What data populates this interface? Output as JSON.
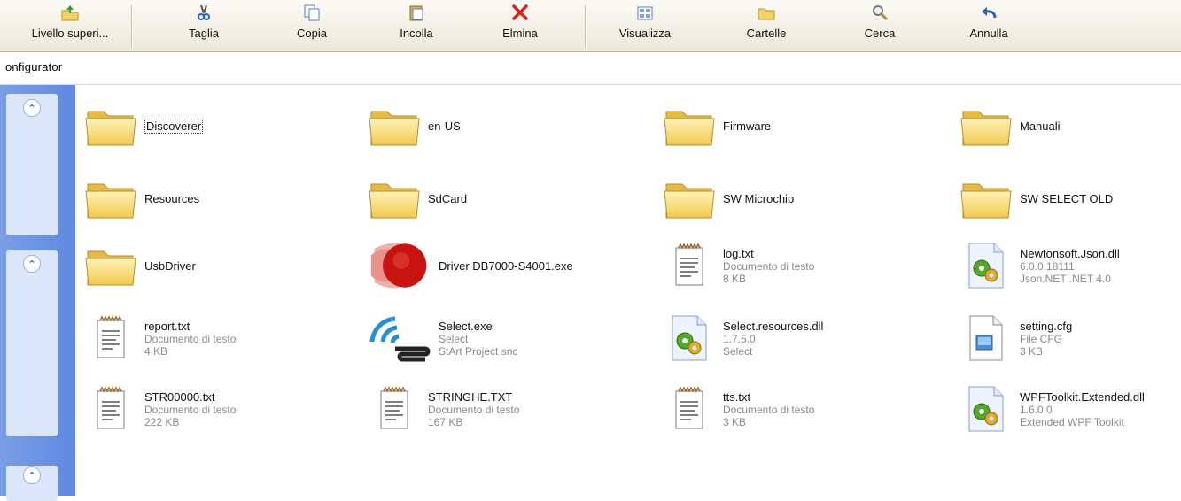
{
  "toolbar": {
    "buttons": [
      {
        "label": "Livello superi...",
        "icon": "folder-up-icon"
      },
      {
        "label": "Taglia",
        "icon": "scissors-icon"
      },
      {
        "label": "Copia",
        "icon": "copy-icon"
      },
      {
        "label": "Incolla",
        "icon": "paste-icon"
      },
      {
        "label": "Elmina",
        "icon": "delete-icon"
      },
      {
        "label": "Visualizza",
        "icon": "view-icon"
      },
      {
        "label": "Cartelle",
        "icon": "folders-icon"
      },
      {
        "label": "Cerca",
        "icon": "search-icon"
      },
      {
        "label": "Annulla",
        "icon": "undo-icon"
      }
    ]
  },
  "address": {
    "text": "onfigurator"
  },
  "files": [
    {
      "name": "Discoverer",
      "type": "folder",
      "selected": true
    },
    {
      "name": "en-US",
      "type": "folder"
    },
    {
      "name": "Firmware",
      "type": "folder"
    },
    {
      "name": "Manuali",
      "type": "folder"
    },
    {
      "name": "Resources",
      "type": "folder"
    },
    {
      "name": "SdCard",
      "type": "folder"
    },
    {
      "name": "SW Microchip",
      "type": "folder"
    },
    {
      "name": "SW SELECT OLD",
      "type": "folder"
    },
    {
      "name": "UsbDriver",
      "type": "folder"
    },
    {
      "name": "Driver DB7000-S4001.exe",
      "type": "exe-red"
    },
    {
      "name": "log.txt",
      "type": "txt",
      "line1": "Documento di testo",
      "line2": "8 KB"
    },
    {
      "name": "Newtonsoft.Json.dll",
      "type": "dll",
      "line1": "6.0.0.18111",
      "line2": "Json.NET .NET 4.0"
    },
    {
      "name": "report.txt",
      "type": "txt",
      "line1": "Documento di testo",
      "line2": "4 KB"
    },
    {
      "name": "Select.exe",
      "type": "exe-select",
      "line1": "Select",
      "line2": "StArt Project snc"
    },
    {
      "name": "Select.resources.dll",
      "type": "dll",
      "line1": "1.7.5.0",
      "line2": "Select"
    },
    {
      "name": "setting.cfg",
      "type": "cfg",
      "line1": "File CFG",
      "line2": "3 KB"
    },
    {
      "name": "STR00000.txt",
      "type": "txt",
      "line1": "Documento di testo",
      "line2": "222 KB"
    },
    {
      "name": "STRINGHE.TXT",
      "type": "txt",
      "line1": "Documento di testo",
      "line2": "167 KB"
    },
    {
      "name": "tts.txt",
      "type": "txt",
      "line1": "Documento di testo",
      "line2": "3 KB"
    },
    {
      "name": "WPFToolkit.Extended.dll",
      "type": "dll",
      "line1": "1.6.0.0",
      "line2": "Extended WPF Toolkit"
    }
  ]
}
